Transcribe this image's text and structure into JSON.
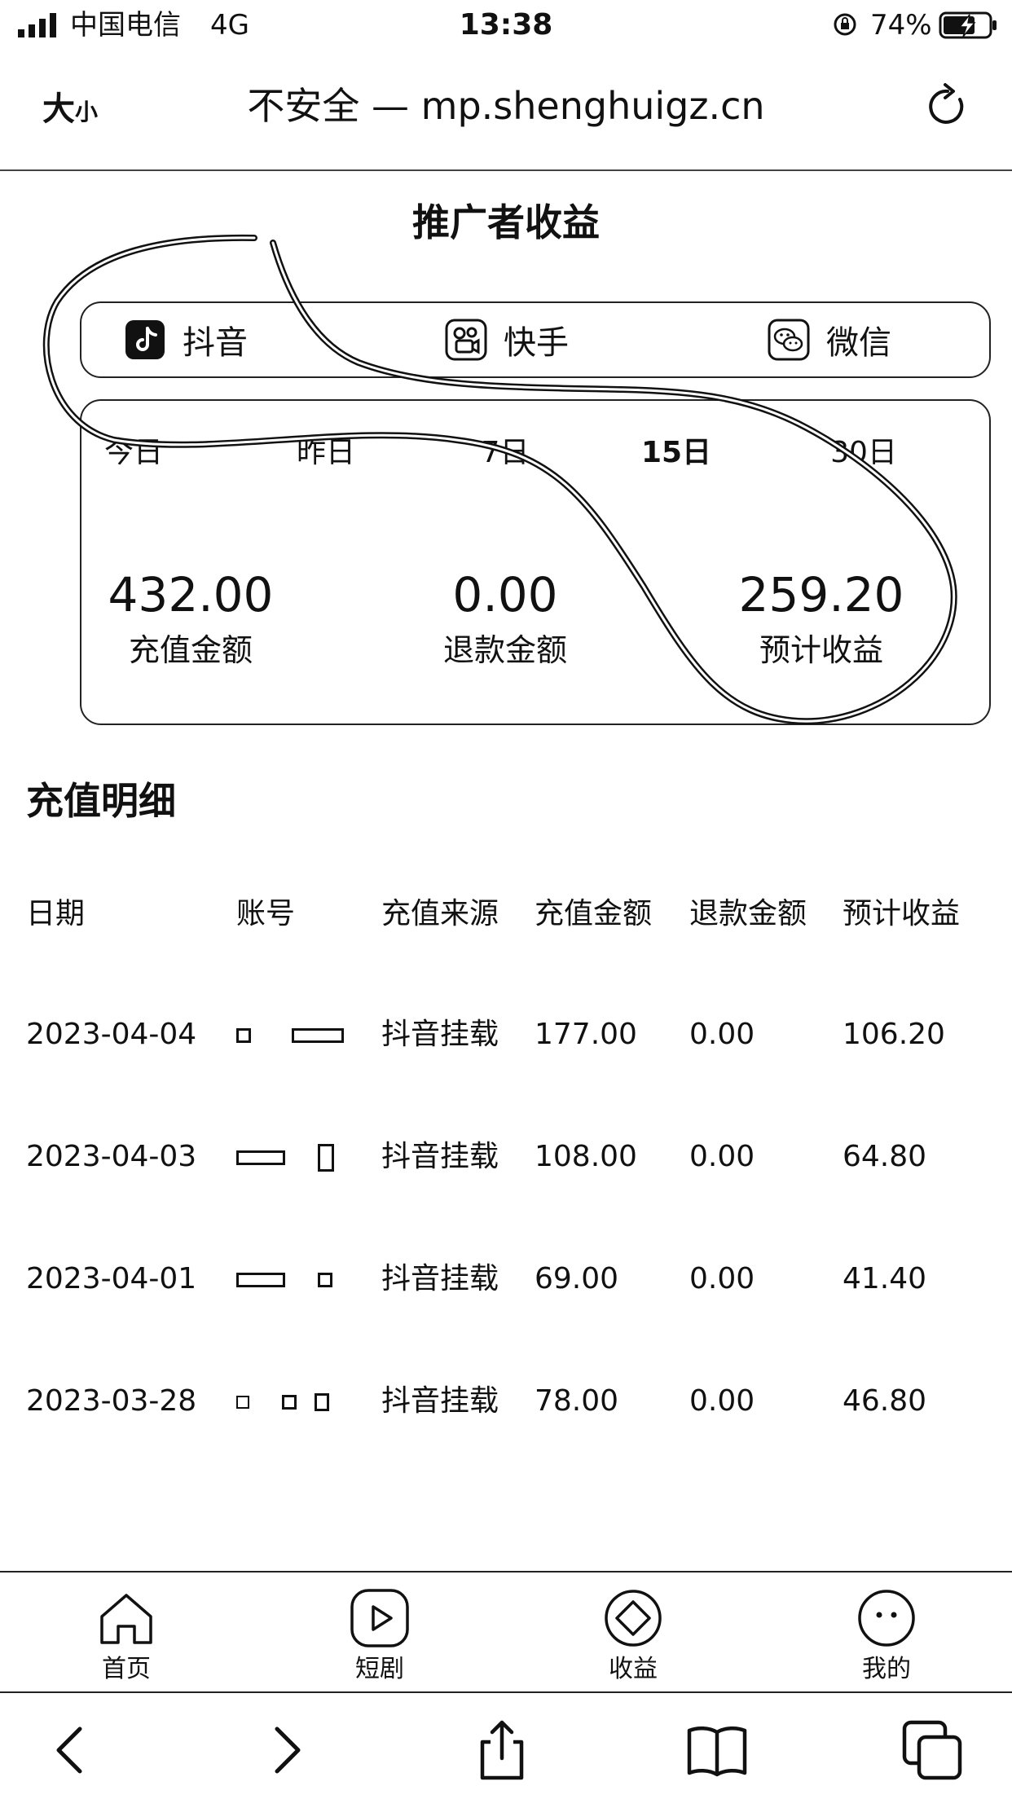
{
  "status_bar": {
    "carrier": "中国电信",
    "network": "4G",
    "time": "13:38",
    "battery": "74%"
  },
  "browser": {
    "text_size_big": "大",
    "text_size_small": "小",
    "url_text": "不安全 — mp.shenghuigz.cn"
  },
  "page": {
    "title": "推广者收益"
  },
  "platform_tabs": [
    {
      "label": "抖音",
      "icon": "tiktok-icon"
    },
    {
      "label": "快手",
      "icon": "kuaishou-icon"
    },
    {
      "label": "微信",
      "icon": "wechat-icon"
    }
  ],
  "range_tabs": [
    "今日",
    "昨日",
    "7日",
    "15日",
    "30日"
  ],
  "range_active": "15日",
  "stats": [
    {
      "value": "432.00",
      "label": "充值金额"
    },
    {
      "value": "0.00",
      "label": "退款金额"
    },
    {
      "value": "259.20",
      "label": "预计收益"
    }
  ],
  "detail": {
    "title": "充值明细",
    "headers": [
      "日期",
      "账号",
      "充值来源",
      "充值金额",
      "退款金额",
      "预计收益"
    ],
    "rows": [
      {
        "date": "2023-04-04",
        "source": "抖音挂载",
        "amount": "177.00",
        "refund": "0.00",
        "income": "106.20"
      },
      {
        "date": "2023-04-03",
        "source": "抖音挂载",
        "amount": "108.00",
        "refund": "0.00",
        "income": "64.80"
      },
      {
        "date": "2023-04-01",
        "source": "抖音挂载",
        "amount": "69.00",
        "refund": "0.00",
        "income": "41.40"
      },
      {
        "date": "2023-03-28",
        "source": "抖音挂载",
        "amount": "78.00",
        "refund": "0.00",
        "income": "46.80"
      }
    ]
  },
  "app_tabs": [
    {
      "label": "首页",
      "icon": "home-icon"
    },
    {
      "label": "短剧",
      "icon": "play-icon"
    },
    {
      "label": "收益",
      "icon": "earnings-icon"
    },
    {
      "label": "我的",
      "icon": "profile-icon"
    }
  ],
  "safari_toolbar": [
    "back-icon",
    "forward-icon",
    "share-icon",
    "bookmarks-icon",
    "tabs-icon"
  ]
}
